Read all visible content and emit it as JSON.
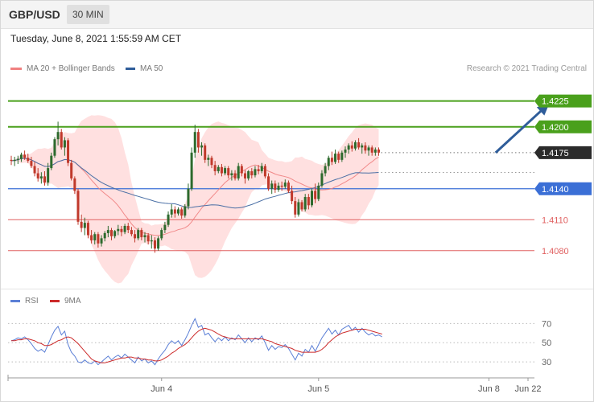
{
  "header": {
    "symbol": "GBP/USD",
    "timeframe": "30 MIN"
  },
  "datetime": "Tuesday, June 8, 2021 1:55:59 AM CET",
  "legend": {
    "ma20": "MA 20 + Bollinger Bands",
    "ma50": "MA 50",
    "credit": "Research © 2021 Trading Central",
    "rsi": "RSI",
    "rsi_ma": "9MA"
  },
  "colors": {
    "up": "#2d6a2d",
    "down": "#c0392b",
    "band": "#ffd6d6",
    "ma20": "#f08080",
    "ma50": "#4a6fa5",
    "resistance": "#4aa01c",
    "support_blue": "#3b6fd6",
    "support_red": "#e06060"
  },
  "chart_data": [
    {
      "type": "candlestick",
      "title": "GBP/USD",
      "ylim": [
        1.4058,
        1.4245
      ],
      "x_ticks": [
        {
          "label": "Jun 4",
          "index": 45
        },
        {
          "label": "Jun 5",
          "index": 92
        },
        {
          "label": "Jun 8",
          "index": 143
        },
        {
          "label": "Jun 22",
          "index": 161
        }
      ],
      "levels": [
        {
          "value": 1.4225,
          "label": "1.4225",
          "kind": "resistance-green"
        },
        {
          "value": 1.42,
          "label": "1.4200",
          "kind": "resistance-green"
        },
        {
          "value": 1.4175,
          "label": "1.4175",
          "kind": "last-price"
        },
        {
          "value": 1.414,
          "label": "1.4140",
          "kind": "support-blue"
        },
        {
          "value": 1.411,
          "label": "1.4110",
          "kind": "support-red"
        },
        {
          "value": 1.408,
          "label": "1.4080",
          "kind": "support-red"
        }
      ],
      "projection": {
        "from": [
          145,
          1.4175
        ],
        "to": [
          161,
          1.4225
        ]
      },
      "candles": [
        [
          1.4168,
          1.4172,
          1.4163,
          1.4167
        ],
        [
          1.4167,
          1.4171,
          1.4162,
          1.4168
        ],
        [
          1.4168,
          1.4172,
          1.4164,
          1.4169
        ],
        [
          1.4169,
          1.4175,
          1.4166,
          1.4173
        ],
        [
          1.4173,
          1.4177,
          1.4168,
          1.417
        ],
        [
          1.417,
          1.4174,
          1.4165,
          1.4167
        ],
        [
          1.4167,
          1.4171,
          1.416,
          1.4162
        ],
        [
          1.4162,
          1.4166,
          1.4152,
          1.4155
        ],
        [
          1.4155,
          1.416,
          1.4147,
          1.415
        ],
        [
          1.415,
          1.4156,
          1.4145,
          1.4152
        ],
        [
          1.4152,
          1.4157,
          1.4143,
          1.4146
        ],
        [
          1.4146,
          1.4165,
          1.4143,
          1.416
        ],
        [
          1.416,
          1.4175,
          1.4158,
          1.4172
        ],
        [
          1.4172,
          1.419,
          1.417,
          1.4188
        ],
        [
          1.4188,
          1.4205,
          1.4182,
          1.4195
        ],
        [
          1.4195,
          1.4198,
          1.4178,
          1.418
        ],
        [
          1.418,
          1.419,
          1.4172,
          1.4187
        ],
        [
          1.4187,
          1.4189,
          1.4162,
          1.4165
        ],
        [
          1.4165,
          1.4168,
          1.4148,
          1.415
        ],
        [
          1.415,
          1.4152,
          1.4135,
          1.4138
        ],
        [
          1.4138,
          1.414,
          1.4105,
          1.4108
        ],
        [
          1.4108,
          1.4115,
          1.4098,
          1.4102
        ],
        [
          1.4102,
          1.4112,
          1.4095,
          1.4107
        ],
        [
          1.4107,
          1.4109,
          1.4092,
          1.4095
        ],
        [
          1.4095,
          1.41,
          1.4087,
          1.409
        ],
        [
          1.409,
          1.4098,
          1.4086,
          1.4096
        ],
        [
          1.4096,
          1.4098,
          1.4083,
          1.4087
        ],
        [
          1.4087,
          1.4095,
          1.4084,
          1.4092
        ],
        [
          1.4092,
          1.4099,
          1.4089,
          1.4097
        ],
        [
          1.4097,
          1.4104,
          1.4093,
          1.41
        ],
        [
          1.41,
          1.4102,
          1.409,
          1.4094
        ],
        [
          1.4094,
          1.41,
          1.4092,
          1.4099
        ],
        [
          1.4099,
          1.4105,
          1.4095,
          1.4101
        ],
        [
          1.4101,
          1.4104,
          1.4094,
          1.4098
        ],
        [
          1.4098,
          1.4106,
          1.4096,
          1.4104
        ],
        [
          1.4104,
          1.4107,
          1.4097,
          1.41
        ],
        [
          1.41,
          1.4103,
          1.4094,
          1.4096
        ],
        [
          1.4096,
          1.41,
          1.4088,
          1.4092
        ],
        [
          1.4092,
          1.4102,
          1.409,
          1.41
        ],
        [
          1.41,
          1.4102,
          1.409,
          1.4093
        ],
        [
          1.4093,
          1.4098,
          1.4088,
          1.4095
        ],
        [
          1.4095,
          1.4097,
          1.4086,
          1.4089
        ],
        [
          1.4089,
          1.4095,
          1.4082,
          1.409
        ],
        [
          1.409,
          1.4093,
          1.4078,
          1.4082
        ],
        [
          1.4082,
          1.4094,
          1.408,
          1.4092
        ],
        [
          1.4092,
          1.4102,
          1.409,
          1.41
        ],
        [
          1.41,
          1.4108,
          1.4097,
          1.4105
        ],
        [
          1.4105,
          1.4118,
          1.4103,
          1.4115
        ],
        [
          1.4115,
          1.4125,
          1.4112,
          1.412
        ],
        [
          1.412,
          1.4123,
          1.4112,
          1.4116
        ],
        [
          1.4116,
          1.4122,
          1.4114,
          1.412
        ],
        [
          1.412,
          1.4122,
          1.4111,
          1.4114
        ],
        [
          1.4114,
          1.4125,
          1.4112,
          1.4123
        ],
        [
          1.4123,
          1.4145,
          1.412,
          1.414
        ],
        [
          1.414,
          1.418,
          1.4138,
          1.4175
        ],
        [
          1.4175,
          1.4202,
          1.417,
          1.4195
        ],
        [
          1.4195,
          1.4198,
          1.4175,
          1.418
        ],
        [
          1.418,
          1.4185,
          1.4172,
          1.4182
        ],
        [
          1.4182,
          1.4184,
          1.4165,
          1.4168
        ],
        [
          1.4168,
          1.4173,
          1.4162,
          1.417
        ],
        [
          1.417,
          1.4172,
          1.416,
          1.4163
        ],
        [
          1.4163,
          1.4167,
          1.4153,
          1.4157
        ],
        [
          1.4157,
          1.4163,
          1.4155,
          1.4161
        ],
        [
          1.4161,
          1.4164,
          1.4152,
          1.4155
        ],
        [
          1.4155,
          1.4162,
          1.4153,
          1.416
        ],
        [
          1.416,
          1.4162,
          1.415,
          1.4153
        ],
        [
          1.4153,
          1.4158,
          1.4148,
          1.4155
        ],
        [
          1.4155,
          1.4158,
          1.4148,
          1.415
        ],
        [
          1.415,
          1.4165,
          1.4148,
          1.4162
        ],
        [
          1.4162,
          1.4164,
          1.4152,
          1.4155
        ],
        [
          1.4155,
          1.4158,
          1.4145,
          1.415
        ],
        [
          1.415,
          1.4158,
          1.4148,
          1.4157
        ],
        [
          1.4157,
          1.416,
          1.415,
          1.4153
        ],
        [
          1.4153,
          1.4162,
          1.4151,
          1.4159
        ],
        [
          1.4159,
          1.4163,
          1.4154,
          1.4157
        ],
        [
          1.4157,
          1.4165,
          1.4155,
          1.4162
        ],
        [
          1.4162,
          1.4164,
          1.415,
          1.4152
        ],
        [
          1.4152,
          1.4155,
          1.4138,
          1.414
        ],
        [
          1.414,
          1.4148,
          1.4135,
          1.4145
        ],
        [
          1.4145,
          1.4148,
          1.4136,
          1.4139
        ],
        [
          1.4139,
          1.4146,
          1.4137,
          1.4143
        ],
        [
          1.4143,
          1.4147,
          1.4138,
          1.4142
        ],
        [
          1.4142,
          1.4149,
          1.414,
          1.4146
        ],
        [
          1.4146,
          1.4148,
          1.4136,
          1.4138
        ],
        [
          1.4138,
          1.4143,
          1.4125,
          1.4128
        ],
        [
          1.4128,
          1.4132,
          1.4112,
          1.4115
        ],
        [
          1.4115,
          1.413,
          1.4113,
          1.4127
        ],
        [
          1.4127,
          1.4129,
          1.4118,
          1.412
        ],
        [
          1.412,
          1.4135,
          1.4118,
          1.4132
        ],
        [
          1.4132,
          1.4135,
          1.412,
          1.4124
        ],
        [
          1.4124,
          1.414,
          1.4122,
          1.4138
        ],
        [
          1.4138,
          1.4145,
          1.4126,
          1.413
        ],
        [
          1.413,
          1.4146,
          1.4128,
          1.4143
        ],
        [
          1.4143,
          1.4158,
          1.4141,
          1.4155
        ],
        [
          1.4155,
          1.4165,
          1.4152,
          1.4162
        ],
        [
          1.4162,
          1.4172,
          1.4158,
          1.417
        ],
        [
          1.417,
          1.4176,
          1.4163,
          1.4166
        ],
        [
          1.4166,
          1.4178,
          1.4164,
          1.4174
        ],
        [
          1.4174,
          1.4176,
          1.4165,
          1.4168
        ],
        [
          1.4168,
          1.4177,
          1.4166,
          1.4175
        ],
        [
          1.4175,
          1.4181,
          1.417,
          1.4178
        ],
        [
          1.4178,
          1.4184,
          1.4174,
          1.4182
        ],
        [
          1.4182,
          1.4186,
          1.4176,
          1.4179
        ],
        [
          1.4179,
          1.4187,
          1.4177,
          1.4185
        ],
        [
          1.4185,
          1.4189,
          1.4178,
          1.418
        ],
        [
          1.418,
          1.4184,
          1.4174,
          1.4182
        ],
        [
          1.4182,
          1.4185,
          1.4174,
          1.4177
        ],
        [
          1.4177,
          1.4182,
          1.4172,
          1.418
        ],
        [
          1.418,
          1.4182,
          1.4172,
          1.4175
        ],
        [
          1.4175,
          1.418,
          1.4172,
          1.4178
        ],
        [
          1.4178,
          1.418,
          1.4172,
          1.4175
        ]
      ]
    },
    {
      "type": "line",
      "title": "RSI",
      "ylim": [
        20,
        82
      ],
      "y_ticks": [
        30,
        50,
        70
      ],
      "series": [
        {
          "name": "RSI",
          "color": "#5b7fd6",
          "values": [
            52,
            53,
            55,
            54,
            56,
            53,
            49,
            44,
            41,
            43,
            40,
            48,
            56,
            63,
            67,
            58,
            62,
            48,
            40,
            36,
            30,
            29,
            32,
            29,
            28,
            31,
            27,
            30,
            33,
            36,
            32,
            35,
            37,
            34,
            38,
            35,
            32,
            29,
            35,
            31,
            33,
            29,
            31,
            27,
            33,
            38,
            42,
            48,
            52,
            49,
            52,
            47,
            53,
            60,
            68,
            75,
            66,
            68,
            58,
            60,
            55,
            51,
            55,
            52,
            56,
            52,
            55,
            53,
            58,
            54,
            50,
            55,
            51,
            55,
            53,
            57,
            50,
            42,
            47,
            43,
            46,
            45,
            48,
            44,
            38,
            32,
            39,
            36,
            43,
            40,
            47,
            41,
            48,
            55,
            60,
            65,
            59,
            63,
            58,
            64,
            66,
            68,
            63,
            66,
            61,
            65,
            61,
            58,
            60,
            57,
            58,
            56
          ]
        },
        {
          "name": "9MA",
          "color": "#cc2a2a",
          "values": [
            52,
            52,
            53,
            53,
            54,
            54,
            53,
            52,
            50,
            49,
            47,
            47,
            48,
            50,
            52,
            53,
            55,
            56,
            55,
            52,
            49,
            45,
            41,
            37,
            33,
            31,
            30,
            29,
            29,
            30,
            31,
            32,
            33,
            34,
            34,
            35,
            35,
            34,
            34,
            33,
            33,
            32,
            32,
            31,
            31,
            32,
            34,
            36,
            39,
            41,
            44,
            46,
            48,
            51,
            55,
            59,
            62,
            64,
            65,
            64,
            63,
            61,
            59,
            57,
            56,
            55,
            54,
            54,
            54,
            54,
            54,
            54,
            54,
            54,
            54,
            54,
            53,
            52,
            51,
            49,
            48,
            47,
            46,
            45,
            44,
            42,
            41,
            40,
            40,
            40,
            40,
            40,
            41,
            43,
            46,
            50,
            53,
            56,
            58,
            60,
            61,
            62,
            63,
            64,
            64,
            64,
            64,
            63,
            62,
            61,
            60,
            59
          ]
        }
      ]
    }
  ]
}
